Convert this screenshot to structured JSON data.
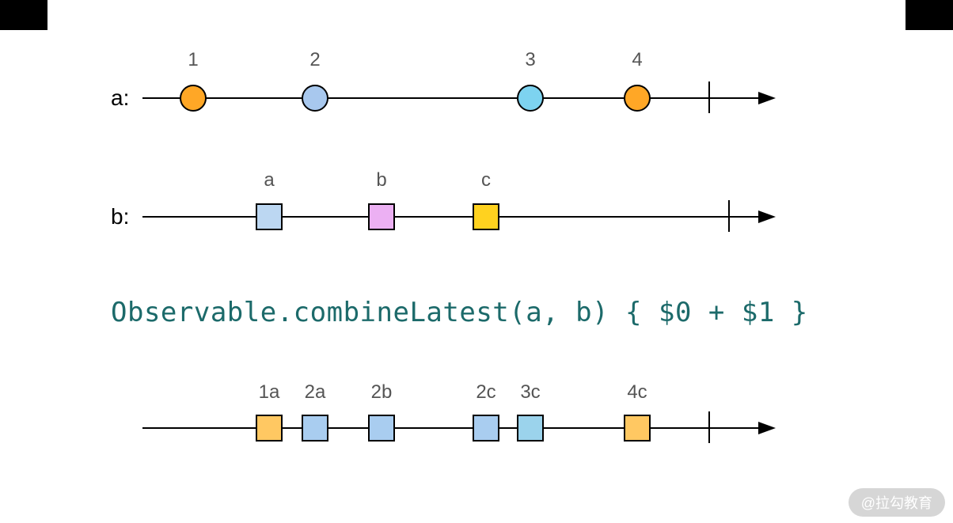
{
  "chart_data": {
    "type": "marble-diagram",
    "operator": "Observable.combineLatest(a, b) { $0 + $1 }",
    "streams": {
      "a": {
        "label": "a:",
        "events": [
          {
            "time": 1.0,
            "value": "1",
            "color": "#ffa726"
          },
          {
            "time": 3.0,
            "value": "2",
            "color": "#90caf9"
          },
          {
            "time": 5.7,
            "value": "3",
            "color": "#4fc3f7"
          },
          {
            "time": 7.2,
            "value": "4",
            "color": "#ffa726"
          }
        ],
        "complete": 8.5
      },
      "b": {
        "label": "b:",
        "events": [
          {
            "time": 2.2,
            "value": "a",
            "color": "#bbdefb"
          },
          {
            "time": 4.0,
            "value": "b",
            "color": "#e1a7f2"
          },
          {
            "time": 5.2,
            "value": "c",
            "color": "#ffd21f"
          }
        ],
        "complete": 8.8
      },
      "output": {
        "events": [
          {
            "time": 2.2,
            "value": "1a",
            "color": "#ffc862"
          },
          {
            "time": 3.0,
            "value": "2a",
            "color": "#a9cdf0"
          },
          {
            "time": 4.0,
            "value": "2b",
            "color": "#a9cdf0"
          },
          {
            "time": 5.2,
            "value": "2c",
            "color": "#a9cdf0"
          },
          {
            "time": 5.7,
            "value": "3c",
            "color": "#9bd3ec"
          },
          {
            "time": 7.2,
            "value": "4c",
            "color": "#ffc862"
          }
        ],
        "complete": 8.5
      }
    }
  },
  "labels": {
    "a": "a:",
    "b": "b:"
  },
  "code": "Observable.combineLatest(a, b) { $0 + $1 }",
  "marbles": {
    "a1": "1",
    "a2": "2",
    "a3": "3",
    "a4": "4",
    "ba": "a",
    "bb": "b",
    "bc": "c",
    "o1": "1a",
    "o2": "2a",
    "o3": "2b",
    "o4": "2c",
    "o5": "3c",
    "o6": "4c"
  },
  "watermark": "@拉勾教育"
}
